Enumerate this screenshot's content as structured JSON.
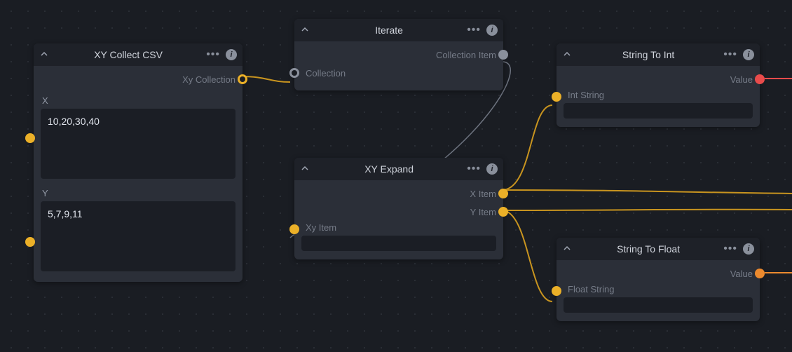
{
  "nodes": {
    "xy_collect": {
      "title": "XY Collect CSV",
      "out_label": "Xy Collection",
      "x_label": "X",
      "x_value": "10,20,30,40",
      "y_label": "Y",
      "y_value": "5,7,9,11"
    },
    "iterate": {
      "title": "Iterate",
      "out_label": "Collection Item",
      "in_label": "Collection"
    },
    "xy_expand": {
      "title": "XY Expand",
      "out_x": "X Item",
      "out_y": "Y Item",
      "in_label": "Xy Item"
    },
    "str_to_int": {
      "title": "String To Int",
      "out_label": "Value",
      "in_label": "Int String"
    },
    "str_to_float": {
      "title": "String To Float",
      "out_label": "Value",
      "in_label": "Float String"
    }
  },
  "colors": {
    "wire_yellow": "#c8941f",
    "wire_gray": "#6e7480"
  }
}
